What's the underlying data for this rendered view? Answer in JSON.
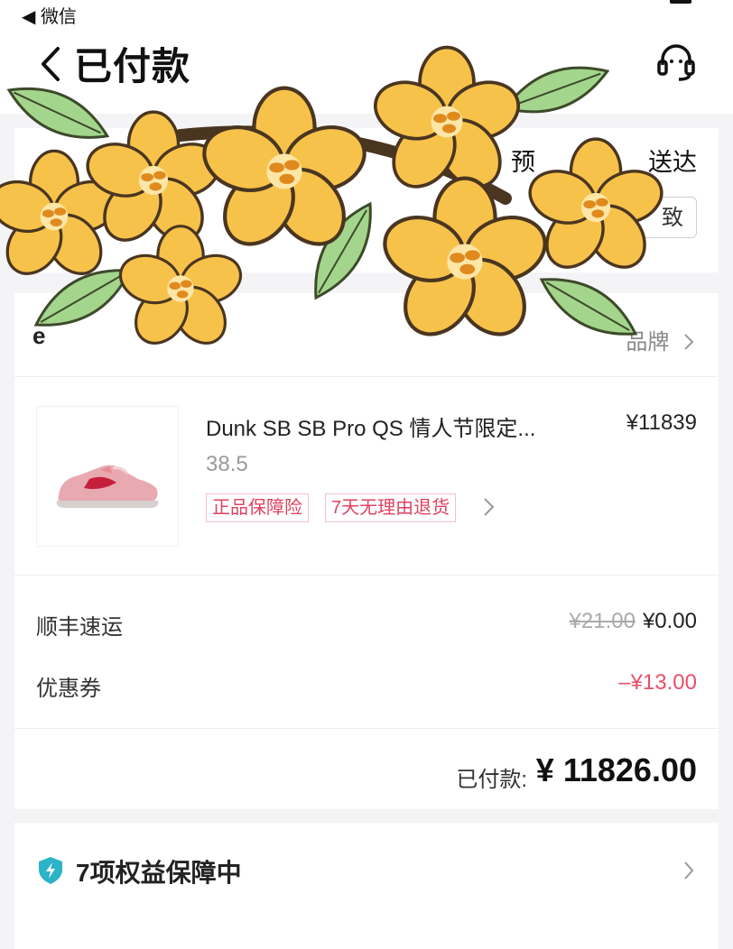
{
  "status_bar": {
    "back_app": "◀ 微信"
  },
  "header": {
    "title": "已付款"
  },
  "delivery": {
    "prefix": "预",
    "text": "送达",
    "button_label": "致"
  },
  "store": {
    "name_partial": "e",
    "brand_link": "品牌"
  },
  "product": {
    "name": "Dunk SB SB Pro QS 情人节限定...",
    "price": "¥11839",
    "size": "38.5",
    "tags": [
      "正品保障险",
      "7天无理由退货"
    ]
  },
  "fees": [
    {
      "label": "顺丰速运",
      "original": "¥21.00",
      "value": "¥0.00"
    },
    {
      "label": "优惠券",
      "value": "–¥13.00"
    }
  ],
  "payment": {
    "label": "已付款:",
    "amount": "¥ 11826.00"
  },
  "benefits": {
    "label": "7项权益保障中"
  },
  "colors": {
    "accent_red": "#e0425f",
    "shield_teal": "#2bb3c8",
    "flower_yellow": "#f7c24a",
    "leaf_green": "#9fd48a"
  }
}
